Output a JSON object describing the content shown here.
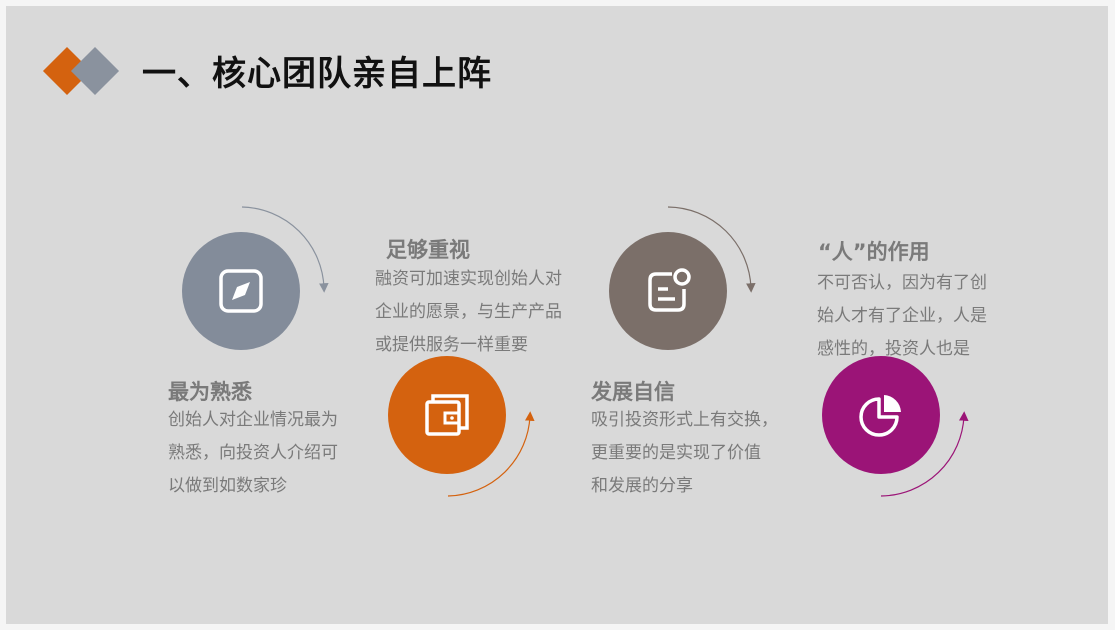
{
  "title": "一、核心团队亲自上阵",
  "colors": {
    "orange": "#d4620f",
    "gray_blue": "#838c9a",
    "brown_gray": "#7b6f69",
    "magenta": "#9b1477",
    "text_gray": "#7a7a7a"
  },
  "items": [
    {
      "heading": "最为熟悉",
      "lines": [
        "创始人对企业情况最为",
        "熟悉，向投资人介绍可",
        "以做到如数家珍"
      ],
      "icon": "compass-icon"
    },
    {
      "heading": "足够重视",
      "lines": [
        "融资可加速实现创始人对",
        "企业的愿景，与生产产品",
        "或提供服务一样重要"
      ],
      "icon": "wallet-icon"
    },
    {
      "heading": "发展自信",
      "lines": [
        "吸引投资形式上有交换，",
        "更重要的是实现了价值",
        "和发展的分享"
      ],
      "icon": "notification-icon"
    },
    {
      "heading": "“人”的作用",
      "lines": [
        "不可否认，因为有了创",
        "始人才有了企业，人是",
        "感性的，投资人也是"
      ],
      "icon": "pie-chart-icon"
    }
  ]
}
